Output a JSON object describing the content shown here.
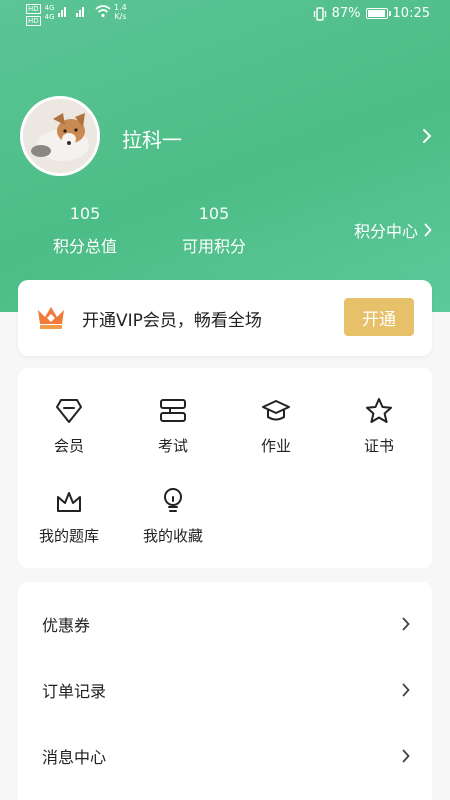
{
  "status_bar": {
    "left_badges": [
      "HD",
      "HD"
    ],
    "left_network": [
      "4G",
      "4G"
    ],
    "speed_value": "1.4",
    "speed_unit": "K/s",
    "battery": "87%",
    "time": "10:25"
  },
  "profile": {
    "username": "拉科一",
    "stats": [
      {
        "value": "105",
        "label": "积分总值"
      },
      {
        "value": "105",
        "label": "可用积分"
      }
    ],
    "points_center_label": "积分中心"
  },
  "vip": {
    "text": "开通VIP会员，畅看全场",
    "button_label": "开通"
  },
  "grid": {
    "items": [
      {
        "label": "会员",
        "icon": "diamond-icon"
      },
      {
        "label": "考试",
        "icon": "exam-icon"
      },
      {
        "label": "作业",
        "icon": "graduation-cap-icon"
      },
      {
        "label": "证书",
        "icon": "star-icon"
      },
      {
        "label": "我的题库",
        "icon": "basket-icon"
      },
      {
        "label": "我的收藏",
        "icon": "bulb-icon"
      }
    ]
  },
  "menu": {
    "items": [
      {
        "label": "优惠券"
      },
      {
        "label": "订单记录"
      },
      {
        "label": "消息中心"
      }
    ]
  },
  "colors": {
    "header_green": "#4cbd86",
    "vip_gold": "#e7c16a",
    "crown_orange": "#ef7a3a"
  }
}
